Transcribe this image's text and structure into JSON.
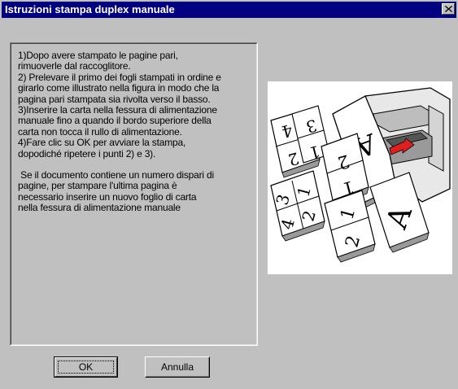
{
  "window": {
    "title": "Istruzioni stampa duplex manuale",
    "close_glyph": "✕"
  },
  "instructions": {
    "paragraphs": [
      "1)Dopo avere stampato le pagine pari,\nrimuoverle dal raccoglitore.",
      "2) Prelevare il primo dei fogli stampati in ordine e\ngirarlo come illustrato nella figura in modo che la\npagina pari stampata sia rivolta verso il basso.",
      "3)Inserire la carta nella fessura di alimentazione\nmanuale fino a quando il bordo superiore della\ncarta non tocca il rullo di alimentazione.",
      "4)Fare clic su OK per avviare la stampa,\ndopodiché ripetere i punti 2) e 3).",
      " Se il documento contiene un numero dispari di\npagine, per stampare l'ultima pagina è\nnecessario inserire un nuovo foglio di carta\nnella fessura di alimentazione manuale"
    ]
  },
  "illustration": {
    "icon": "duplex-printer-illustration",
    "page_labels": [
      "4",
      "3",
      "2",
      "1",
      "2",
      "1",
      "3",
      "1",
      "4",
      "2",
      "1",
      "2",
      "A",
      "A"
    ]
  },
  "buttons": {
    "ok": "OK",
    "cancel": "Annulla"
  },
  "colors": {
    "titlebar": "#000080",
    "dialog": "#c0c0c0",
    "accent_red": "#e02020"
  }
}
